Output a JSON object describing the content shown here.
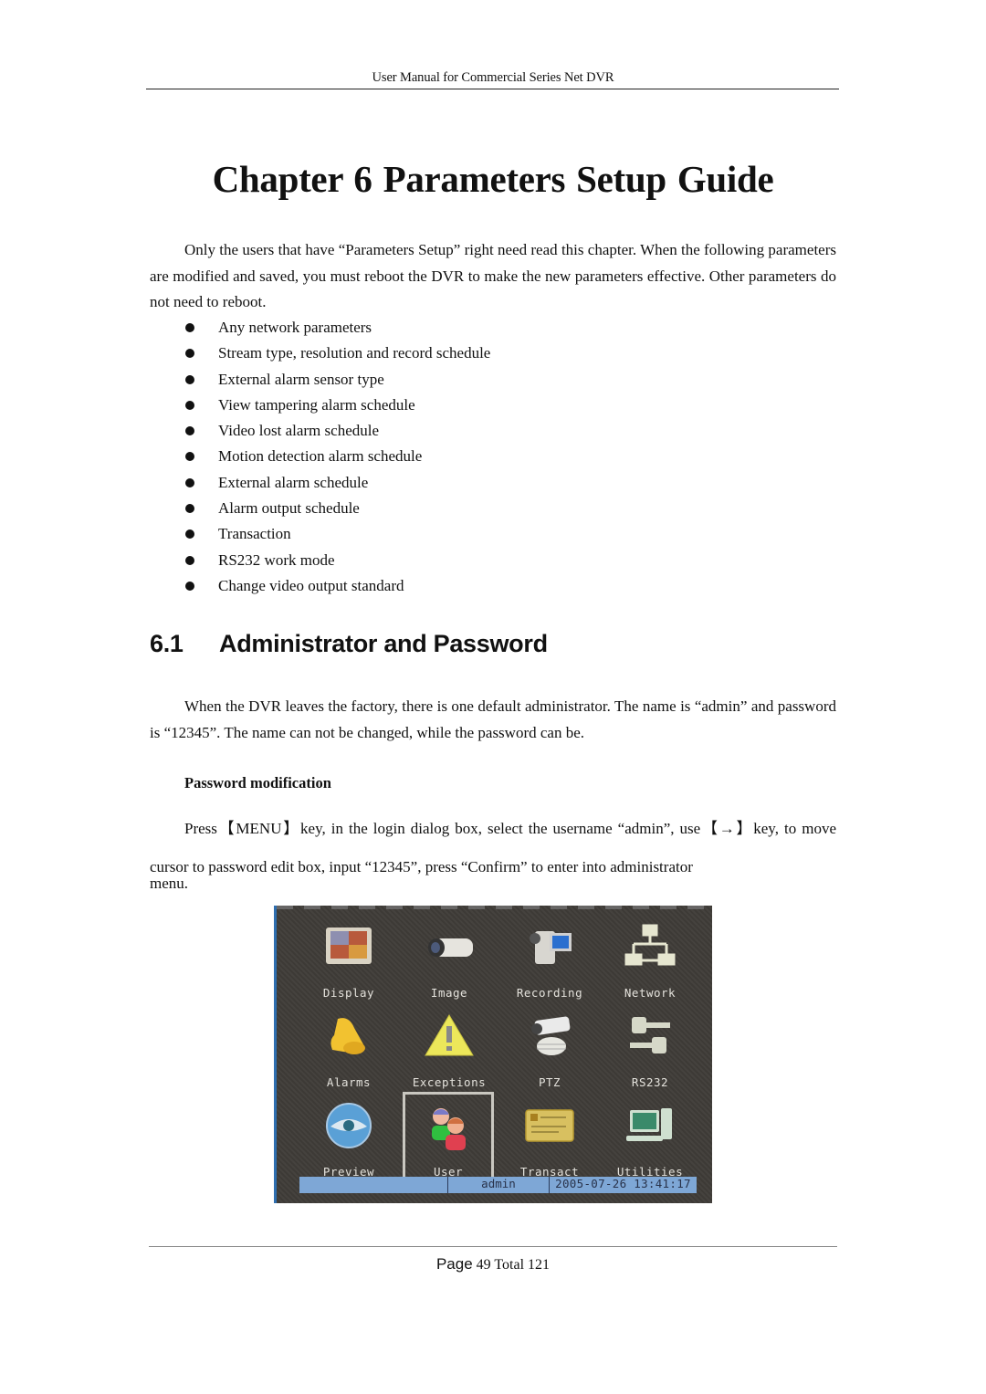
{
  "header": {
    "title": "User Manual for Commercial Series Net DVR"
  },
  "chapter": {
    "title": "Chapter 6  Parameters Setup Guide"
  },
  "intro": {
    "paragraph": "Only the users that have “Parameters Setup” right need read this chapter. When the following parameters are modified and saved, you must reboot the DVR to make the new parameters effective. Other parameters do not need to reboot.",
    "bullets": [
      "Any network parameters",
      "Stream type, resolution and record schedule",
      "External alarm sensor type",
      "View tampering alarm schedule",
      "Video lost alarm schedule",
      "Motion detection alarm schedule",
      "External alarm schedule",
      "Alarm output schedule",
      "Transaction",
      "RS232 work mode",
      "Change video output standard"
    ]
  },
  "section": {
    "number": "6.1",
    "title": "Administrator and Password",
    "paragraph": "When the DVR leaves the factory, there is one default administrator. The name is “admin” and password is “12345”. The name can not be changed, while the password can be.",
    "subheading": "Password modification",
    "instruction": "Press【MENU】key, in the login dialog box, select the username “admin”, use【→】key, to move cursor to password edit box, input “12345”, press “Confirm” to enter into administrator",
    "instruction_end": "menu."
  },
  "dvr_menu": {
    "items": [
      {
        "label": "Display",
        "icon": "display-icon"
      },
      {
        "label": "Image",
        "icon": "camera-icon"
      },
      {
        "label": "Recording",
        "icon": "camcorder-icon"
      },
      {
        "label": "Network",
        "icon": "network-icon"
      },
      {
        "label": "Alarms",
        "icon": "bell-icon"
      },
      {
        "label": "Exceptions",
        "icon": "warning-icon"
      },
      {
        "label": "PTZ",
        "icon": "ptz-camera-icon"
      },
      {
        "label": "RS232",
        "icon": "serial-connector-icon"
      },
      {
        "label": "Preview",
        "icon": "eye-icon"
      },
      {
        "label": "User",
        "icon": "users-icon"
      },
      {
        "label": "Transact",
        "icon": "card-icon"
      },
      {
        "label": "Utilities",
        "icon": "computer-icon"
      }
    ],
    "selected": "User",
    "status": {
      "user": "admin",
      "datetime": "2005-07-26 13:41:17"
    }
  },
  "footer": {
    "page_label": "Page",
    "page": "49",
    "total_label": "Total",
    "total": "121"
  }
}
